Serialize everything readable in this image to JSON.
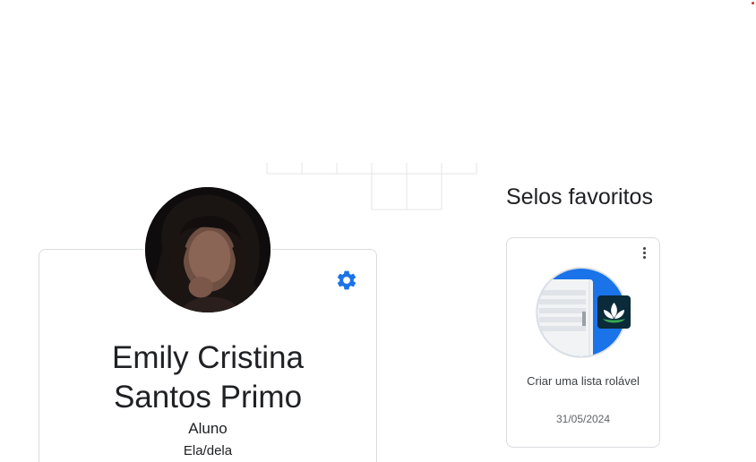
{
  "profile": {
    "name_line1": "Emily Cristina",
    "name_line2": "Santos Primo",
    "role": "Aluno",
    "pronouns": "Ela/dela"
  },
  "badges": {
    "section_title": "Selos favoritos",
    "items": [
      {
        "title": "Criar uma lista rolável",
        "date": "31/05/2024",
        "icon": "lotus-icon"
      }
    ]
  },
  "icons": {
    "settings": "gear-icon",
    "more": "more-vert-icon"
  },
  "colors": {
    "accent": "#1a73e8",
    "badge_dark": "#0b2a3a",
    "lotus_green": "#34a853"
  }
}
